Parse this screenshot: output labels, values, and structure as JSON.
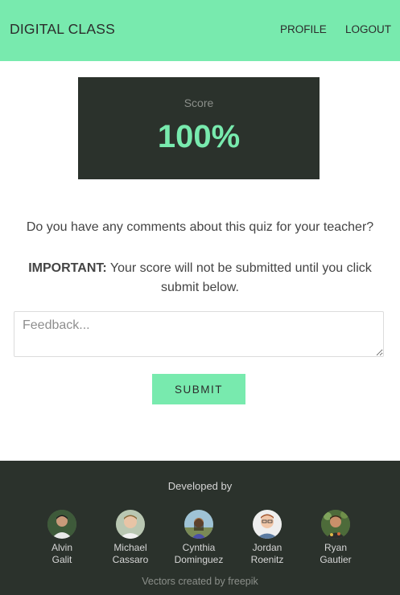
{
  "header": {
    "brand": "DIGITAL CLASS",
    "nav": {
      "profile": "PROFILE",
      "logout": "LOGOUT"
    },
    "background_color": "#78eaae"
  },
  "score": {
    "label": "Score",
    "value": "100%",
    "background_color": "#2b322c",
    "value_color": "#78eaae"
  },
  "question": "Do you have any comments about this quiz for your teacher?",
  "important": {
    "prefix": "IMPORTANT:",
    "text": "Your score will not be submitted until you click submit below."
  },
  "feedback": {
    "placeholder": "Feedback...",
    "value": ""
  },
  "submit_label": "SUBMIT",
  "footer": {
    "developed_by": "Developed by",
    "developers": [
      {
        "first": "Alvin",
        "last": "Galit",
        "avatar": "avatar-photo"
      },
      {
        "first": "Michael",
        "last": "Cassaro",
        "avatar": "avatar-photo"
      },
      {
        "first": "Cynthia",
        "last": "Dominguez",
        "avatar": "avatar-photo"
      },
      {
        "first": "Jordan",
        "last": "Roenitz",
        "avatar": "avatar-photo"
      },
      {
        "first": "Ryan",
        "last": "Gautier",
        "avatar": "avatar-photo"
      }
    ],
    "credit": "Vectors created by freepik"
  }
}
